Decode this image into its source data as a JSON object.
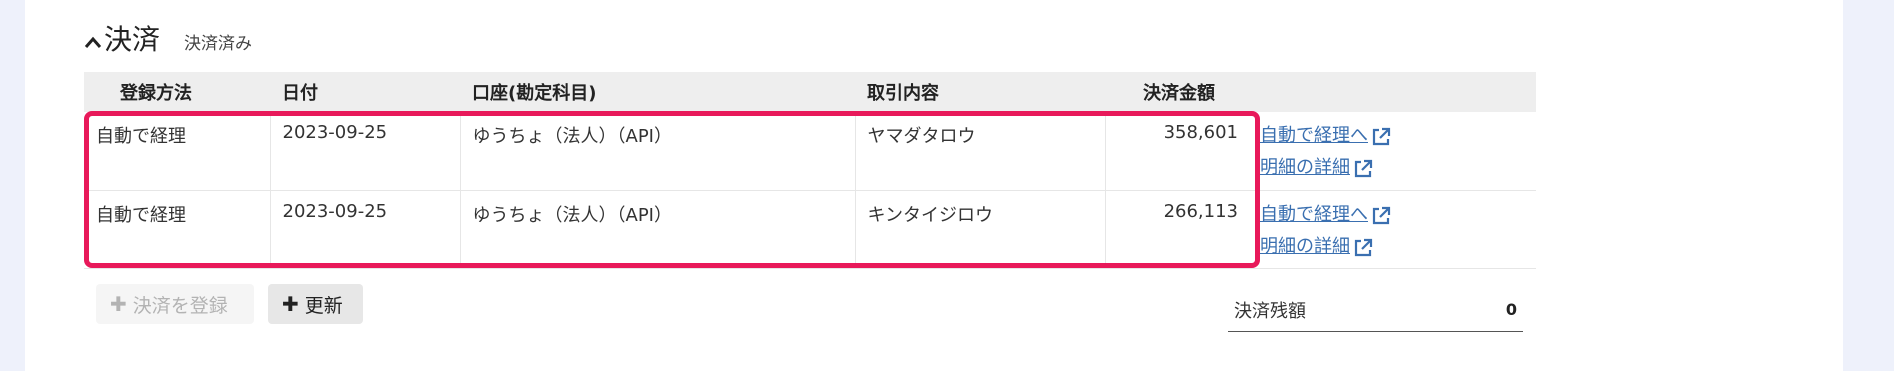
{
  "section": {
    "title": "決済",
    "status": "決済済み",
    "chevron_icon": "chevron-up-icon"
  },
  "table": {
    "headers": [
      "登録方法",
      "日付",
      "口座(勘定科目)",
      "取引内容",
      "決済金額"
    ],
    "rows": [
      {
        "method": "自動で経理",
        "date": "2023-09-25",
        "account": "ゆうちょ（法人）（API）",
        "description": "ヤマダタロウ",
        "amount": "358,601",
        "link_accounting": "自動で経理へ",
        "link_detail": "明細の詳細"
      },
      {
        "method": "自動で経理",
        "date": "2023-09-25",
        "account": "ゆうちょ（法人）（API）",
        "description": "キンタイジロウ",
        "amount": "266,113",
        "link_accounting": "自動で経理へ",
        "link_detail": "明細の詳細"
      }
    ]
  },
  "buttons": {
    "register_label": "決済を登録",
    "refresh_label": "更新"
  },
  "balance": {
    "label": "決済残額",
    "value": "0"
  },
  "colors": {
    "highlight": "#e8195a",
    "link": "#3a6fb0",
    "page_background": "#eef1fb"
  }
}
